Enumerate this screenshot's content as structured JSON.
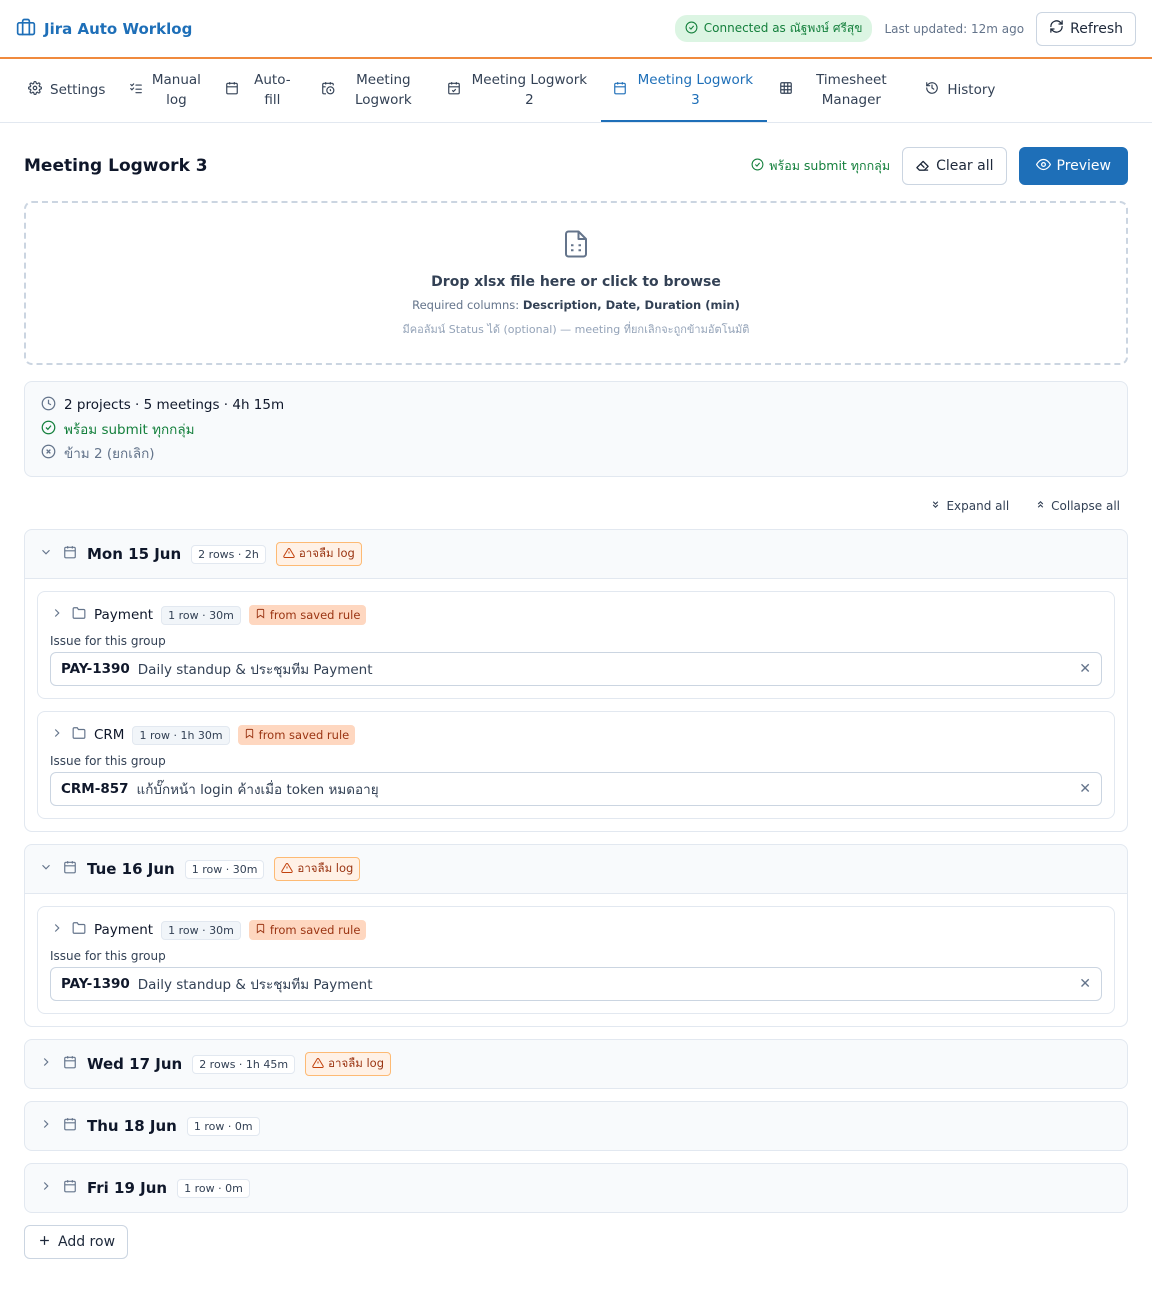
{
  "app": {
    "title": "Jira Auto Worklog",
    "connection": "Connected as ณัฐพงษ์ ศรีสุข",
    "last_updated": "Last updated: 12m ago",
    "refresh_label": "Refresh",
    "accent": "#1e6fb8",
    "header_border": "#f08a3e"
  },
  "tabs": [
    {
      "label": "Settings",
      "icon": "gear-icon"
    },
    {
      "label": "Manual log",
      "icon": "list-check-icon"
    },
    {
      "label": "Auto-fill",
      "icon": "calendar-icon"
    },
    {
      "label": "Meeting Logwork",
      "icon": "calendar-clock-icon"
    },
    {
      "label": "Meeting Logwork 2",
      "icon": "calendar-check-icon"
    },
    {
      "label": "Meeting Logwork 3",
      "icon": "calendar-grid-icon",
      "active": true
    },
    {
      "label": "Timesheet Manager",
      "icon": "table-icon"
    },
    {
      "label": "History",
      "icon": "history-icon"
    }
  ],
  "page": {
    "title": "Meeting Logwork 3",
    "ready_status": "พร้อม submit ทุกกลุ่ม",
    "clear_label": "Clear all",
    "preview_label": "Preview"
  },
  "dropzone": {
    "title": "Drop xlsx file here or click to browse",
    "required_prefix": "Required columns:",
    "required_cols": "Description, Date, Duration (min)",
    "optional_note": "มีคอลัมน์ Status ได้ (optional) — meeting ที่ยกเลิกจะถูกข้ามอัตโนมัติ"
  },
  "summary": {
    "totals": "2 projects · 5 meetings · 4h 15m",
    "ready": "พร้อม submit ทุกกลุ่ม",
    "skipped": "ข้าม 2 (ยกเลิก)"
  },
  "controls": {
    "expand_all": "Expand all",
    "collapse_all": "Collapse all",
    "add_row": "Add row"
  },
  "days": [
    {
      "title": "Mon 15 Jun",
      "meta": "2 rows · 2h",
      "warning": "อาจลืม log",
      "expanded": true,
      "groups": [
        {
          "name": "Payment",
          "meta": "1 row · 30m",
          "rule": "from saved rule",
          "issue_label": "Issue for this group",
          "issue_key": "PAY-1390",
          "issue_summary": "Daily standup & ประชุมทีม Payment"
        },
        {
          "name": "CRM",
          "meta": "1 row · 1h 30m",
          "rule": "from saved rule",
          "issue_label": "Issue for this group",
          "issue_key": "CRM-857",
          "issue_summary": "แก้บั๊กหน้า login ค้างเมื่อ token หมดอายุ"
        }
      ]
    },
    {
      "title": "Tue 16 Jun",
      "meta": "1 row · 30m",
      "warning": "อาจลืม log",
      "expanded": true,
      "groups": [
        {
          "name": "Payment",
          "meta": "1 row · 30m",
          "rule": "from saved rule",
          "issue_label": "Issue for this group",
          "issue_key": "PAY-1390",
          "issue_summary": "Daily standup & ประชุมทีม Payment"
        }
      ]
    },
    {
      "title": "Wed 17 Jun",
      "meta": "2 rows · 1h 45m",
      "warning": "อาจลืม log",
      "expanded": false,
      "groups": []
    },
    {
      "title": "Thu 18 Jun",
      "meta": "1 row · 0m",
      "warning": "",
      "expanded": false,
      "groups": []
    },
    {
      "title": "Fri 19 Jun",
      "meta": "1 row · 0m",
      "warning": "",
      "expanded": false,
      "groups": []
    }
  ]
}
